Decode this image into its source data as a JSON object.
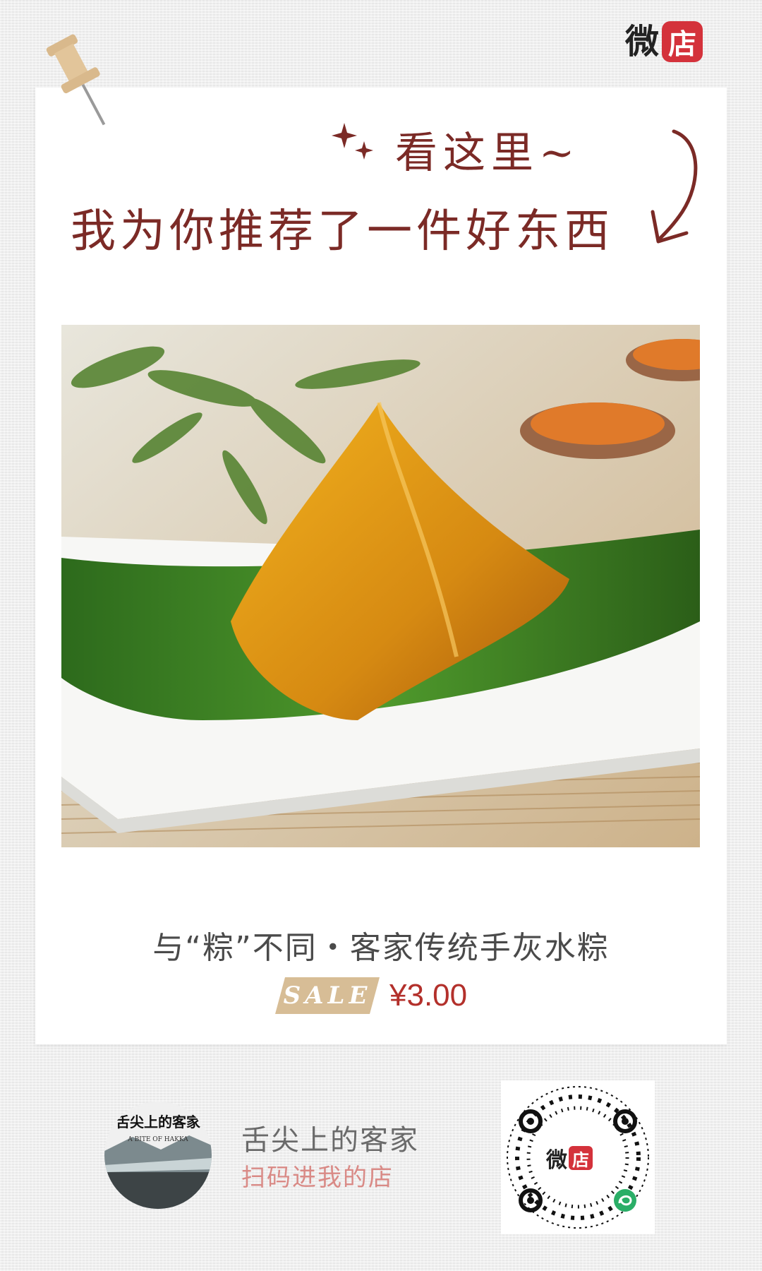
{
  "brand": {
    "wei": "微",
    "dian": "店"
  },
  "headline": {
    "line1": "看这里~",
    "line2": "我为你推荐了一件好东西"
  },
  "product": {
    "title": "与“粽”不同・客家传统手灰水粽",
    "sale_label": "SALE",
    "price": "¥3.00"
  },
  "shop": {
    "avatar_text": "舌尖上的客家",
    "avatar_subtext": "A BITE OF HAKKA",
    "name": "舌尖上的客家",
    "cta": "扫码进我的店"
  },
  "qr": {
    "wei": "微",
    "dian": "店"
  },
  "colors": {
    "headline": "#7b2a26",
    "price": "#b3302b",
    "sale_tag": "#d7bd96",
    "cta": "#d98a86",
    "brand_red": "#d4323b"
  },
  "icons": [
    "pushpin-icon",
    "sparkle-icon",
    "curved-arrow-icon",
    "mini-program-icon"
  ]
}
